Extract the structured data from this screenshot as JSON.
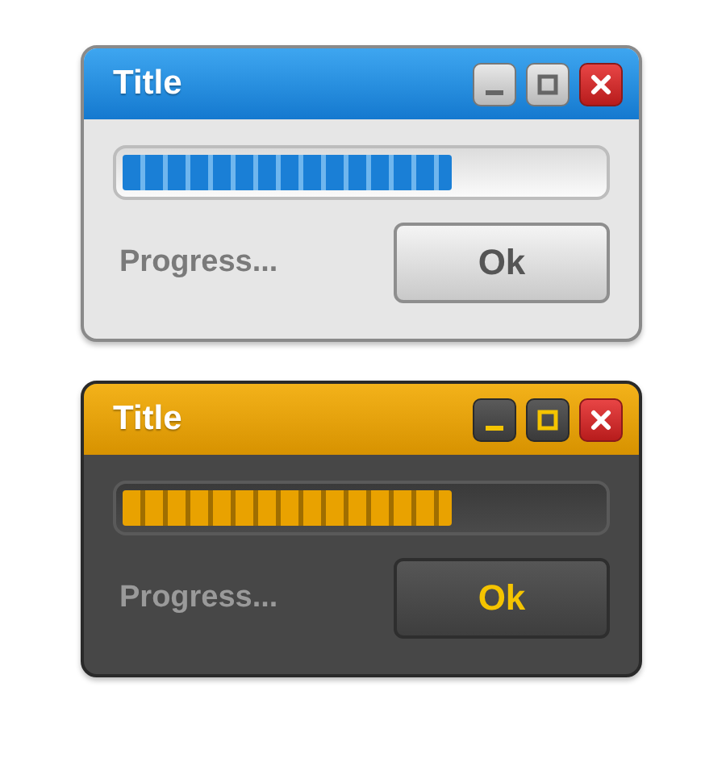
{
  "windows": [
    {
      "kind": "light",
      "title": "Title",
      "progress": {
        "level": 0.69
      },
      "status": "Progress...",
      "button": "Ok"
    },
    {
      "kind": "dark",
      "title": "Title",
      "progress": {
        "level": 0.69
      },
      "status": "Progress...",
      "button": "Ok"
    }
  ]
}
